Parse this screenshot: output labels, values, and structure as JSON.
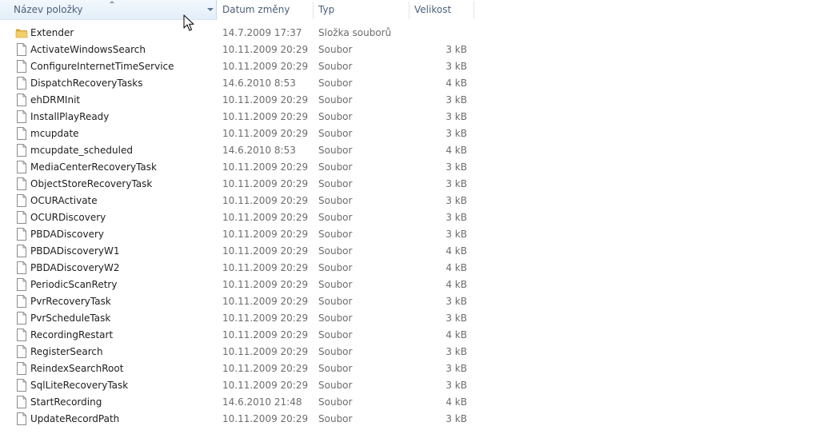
{
  "columns": {
    "name": "Název položky",
    "date": "Datum změny",
    "type": "Typ",
    "size": "Velikost"
  },
  "icons": {
    "folder": "folder-icon",
    "file": "file-icon",
    "cursor": "mouse-cursor-icon"
  },
  "files": [
    {
      "name": "Extender",
      "date": "14.7.2009 17:37",
      "type": "Složka souborů",
      "size": "",
      "kind": "folder"
    },
    {
      "name": "ActivateWindowsSearch",
      "date": "10.11.2009 20:29",
      "type": "Soubor",
      "size": "3 kB",
      "kind": "file"
    },
    {
      "name": "ConfigureInternetTimeService",
      "date": "10.11.2009 20:29",
      "type": "Soubor",
      "size": "3 kB",
      "kind": "file"
    },
    {
      "name": "DispatchRecoveryTasks",
      "date": "14.6.2010 8:53",
      "type": "Soubor",
      "size": "4 kB",
      "kind": "file"
    },
    {
      "name": "ehDRMInit",
      "date": "10.11.2009 20:29",
      "type": "Soubor",
      "size": "3 kB",
      "kind": "file"
    },
    {
      "name": "InstallPlayReady",
      "date": "10.11.2009 20:29",
      "type": "Soubor",
      "size": "3 kB",
      "kind": "file"
    },
    {
      "name": "mcupdate",
      "date": "10.11.2009 20:29",
      "type": "Soubor",
      "size": "3 kB",
      "kind": "file"
    },
    {
      "name": "mcupdate_scheduled",
      "date": "14.6.2010 8:53",
      "type": "Soubor",
      "size": "4 kB",
      "kind": "file"
    },
    {
      "name": "MediaCenterRecoveryTask",
      "date": "10.11.2009 20:29",
      "type": "Soubor",
      "size": "3 kB",
      "kind": "file"
    },
    {
      "name": "ObjectStoreRecoveryTask",
      "date": "10.11.2009 20:29",
      "type": "Soubor",
      "size": "3 kB",
      "kind": "file"
    },
    {
      "name": "OCURActivate",
      "date": "10.11.2009 20:29",
      "type": "Soubor",
      "size": "3 kB",
      "kind": "file"
    },
    {
      "name": "OCURDiscovery",
      "date": "10.11.2009 20:29",
      "type": "Soubor",
      "size": "3 kB",
      "kind": "file"
    },
    {
      "name": "PBDADiscovery",
      "date": "10.11.2009 20:29",
      "type": "Soubor",
      "size": "3 kB",
      "kind": "file"
    },
    {
      "name": "PBDADiscoveryW1",
      "date": "10.11.2009 20:29",
      "type": "Soubor",
      "size": "4 kB",
      "kind": "file"
    },
    {
      "name": "PBDADiscoveryW2",
      "date": "10.11.2009 20:29",
      "type": "Soubor",
      "size": "4 kB",
      "kind": "file"
    },
    {
      "name": "PeriodicScanRetry",
      "date": "10.11.2009 20:29",
      "type": "Soubor",
      "size": "4 kB",
      "kind": "file"
    },
    {
      "name": "PvrRecoveryTask",
      "date": "10.11.2009 20:29",
      "type": "Soubor",
      "size": "3 kB",
      "kind": "file"
    },
    {
      "name": "PvrScheduleTask",
      "date": "10.11.2009 20:29",
      "type": "Soubor",
      "size": "3 kB",
      "kind": "file"
    },
    {
      "name": "RecordingRestart",
      "date": "10.11.2009 20:29",
      "type": "Soubor",
      "size": "4 kB",
      "kind": "file"
    },
    {
      "name": "RegisterSearch",
      "date": "10.11.2009 20:29",
      "type": "Soubor",
      "size": "3 kB",
      "kind": "file"
    },
    {
      "name": "ReindexSearchRoot",
      "date": "10.11.2009 20:29",
      "type": "Soubor",
      "size": "3 kB",
      "kind": "file"
    },
    {
      "name": "SqlLiteRecoveryTask",
      "date": "10.11.2009 20:29",
      "type": "Soubor",
      "size": "3 kB",
      "kind": "file"
    },
    {
      "name": "StartRecording",
      "date": "14.6.2010 21:48",
      "type": "Soubor",
      "size": "4 kB",
      "kind": "file"
    },
    {
      "name": "UpdateRecordPath",
      "date": "10.11.2009 20:29",
      "type": "Soubor",
      "size": "3 kB",
      "kind": "file"
    }
  ]
}
